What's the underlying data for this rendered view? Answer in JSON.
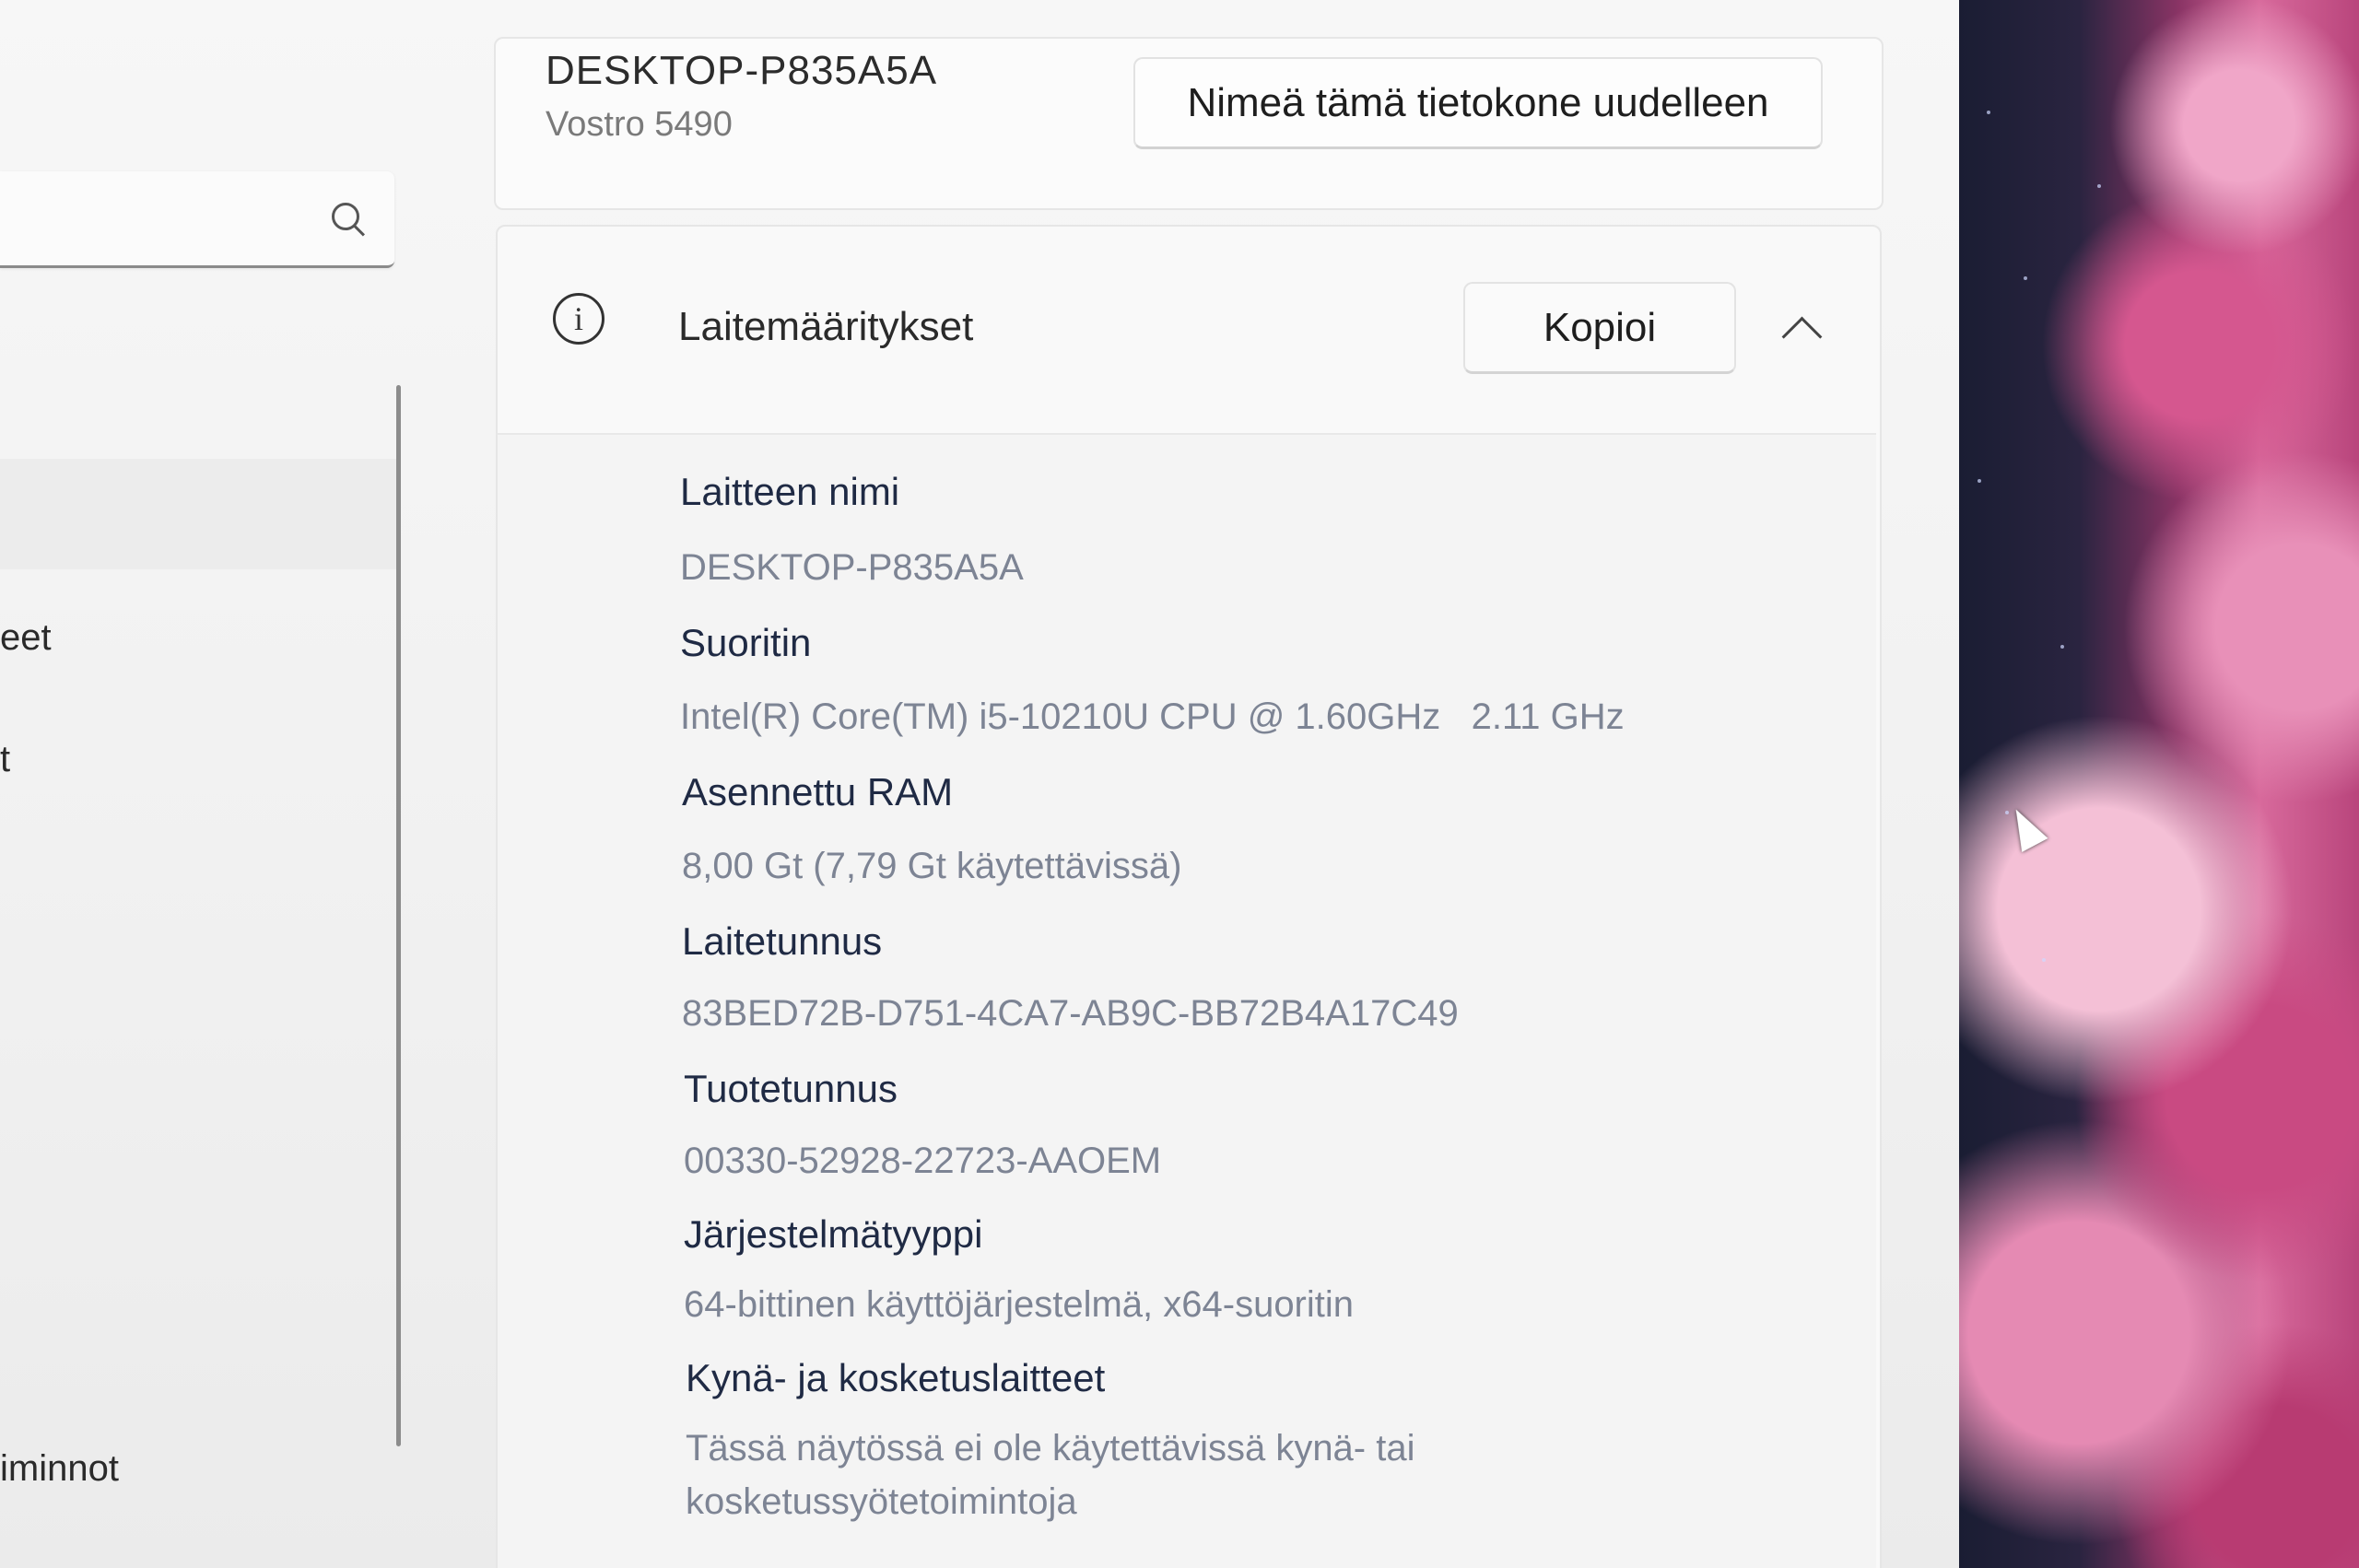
{
  "device": {
    "name": "DESKTOP-P835A5A",
    "model": "Vostro 5490",
    "rename_label": "Nimeä tämä tietokone uudelleen"
  },
  "nav": {
    "partial_items": [
      "eet",
      "t",
      "iminnot"
    ]
  },
  "specs": {
    "title": "Laitemääritykset",
    "copy_label": "Kopioi",
    "rows": [
      {
        "label": "Laitteen nimi",
        "value": "DESKTOP-P835A5A"
      },
      {
        "label": "Suoritin",
        "value": "Intel(R) Core(TM) i5-10210U CPU @ 1.60GHz   2.11 GHz"
      },
      {
        "label": "Asennettu RAM",
        "value": "8,00 Gt (7,79 Gt käytettävissä)"
      },
      {
        "label": "Laitetunnus",
        "value": "83BED72B-D751-4CA7-AB9C-BB72B4A17C49"
      },
      {
        "label": "Tuotetunnus",
        "value": "00330-52928-22723-AAOEM"
      },
      {
        "label": "Järjestelmätyyppi",
        "value": "64-bittinen käyttöjärjestelmä, x64-suoritin"
      },
      {
        "label": "Kynä- ja kosketuslaitteet",
        "value_line1": "Tässä näytössä ei ole käytettävissä kynä- tai",
        "value_line2": "kosketussyötetoimintoja"
      }
    ]
  }
}
